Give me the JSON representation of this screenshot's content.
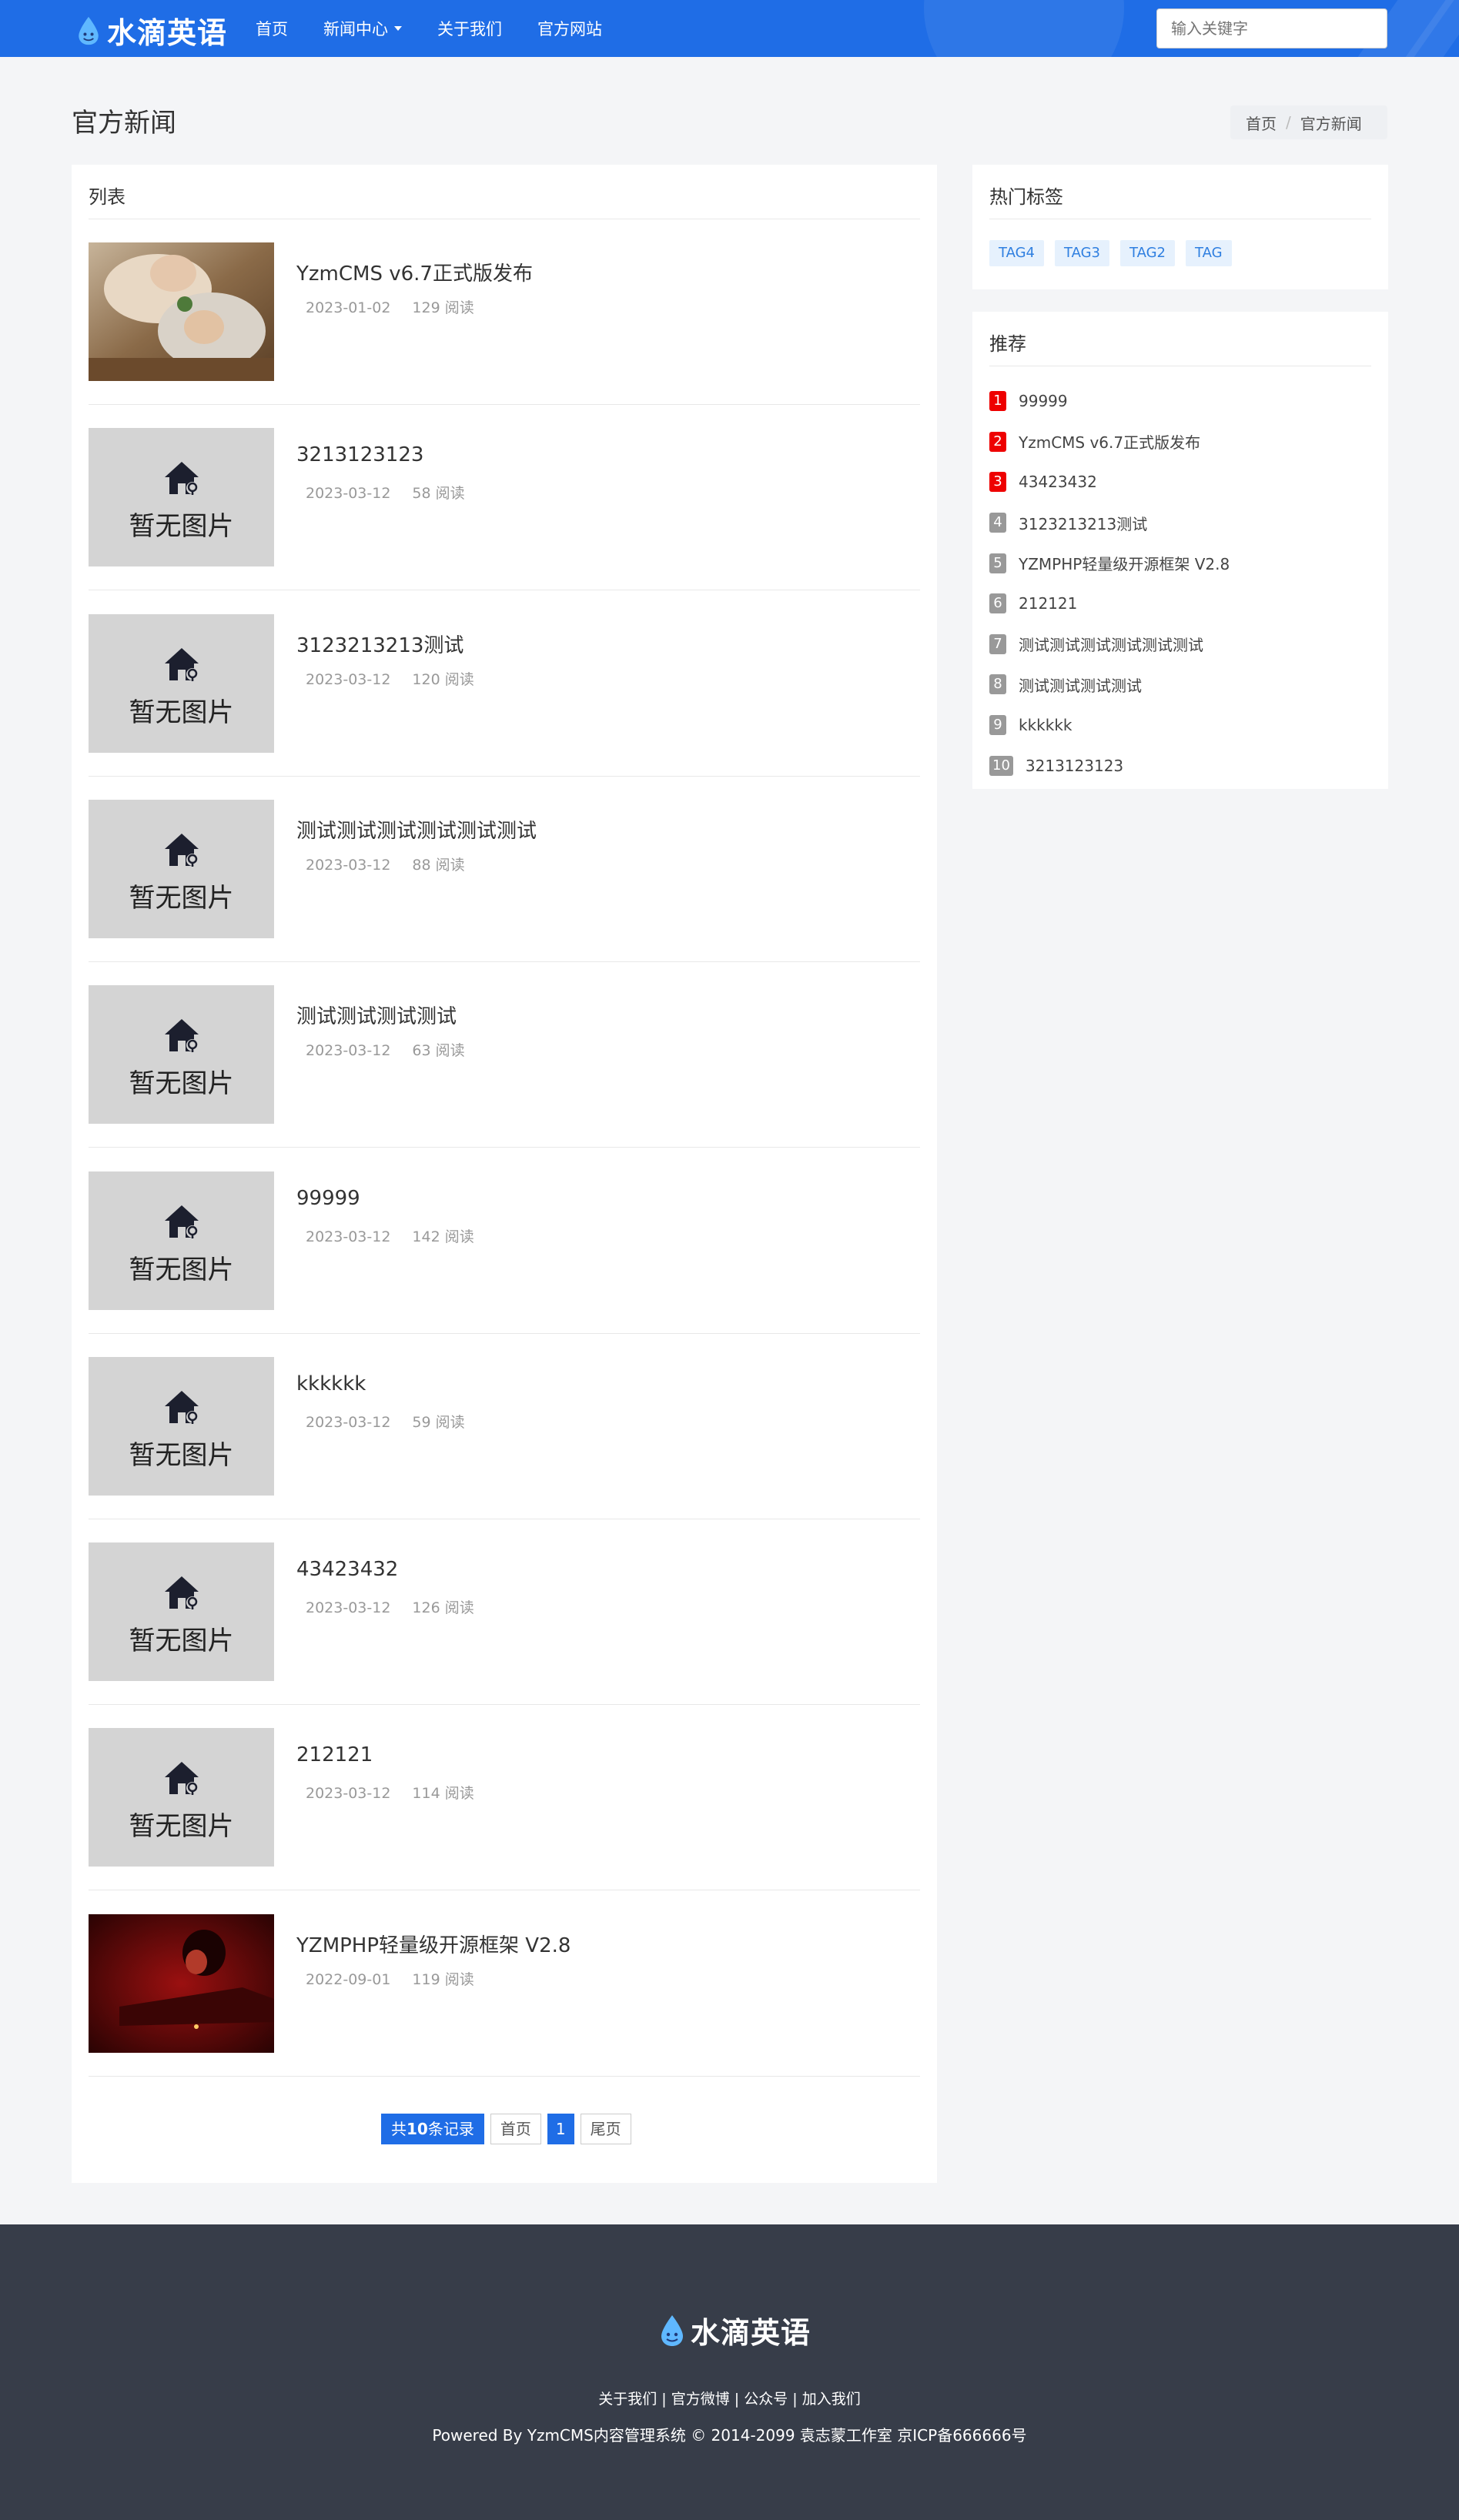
{
  "header": {
    "logo_text": "水滴英语",
    "nav": [
      "首页",
      "新闻中心",
      "关于我们",
      "官方网站"
    ],
    "search_placeholder": "输入关键字"
  },
  "page": {
    "title": "官方新闻",
    "breadcrumb": [
      "首页",
      "官方新闻"
    ]
  },
  "list": {
    "heading": "列表",
    "no_image_text": "暂无图片",
    "items": [
      {
        "title": "YzmCMS v6.7正式版发布",
        "date": "2023-01-02",
        "views": "129 阅读",
        "image": "photo-couple"
      },
      {
        "title": "3213123123",
        "date": "2023-03-12",
        "views": "58 阅读",
        "image": "none"
      },
      {
        "title": "3123213213测试",
        "date": "2023-03-12",
        "views": "120 阅读",
        "image": "none"
      },
      {
        "title": "测试测试测试测试测试测试",
        "date": "2023-03-12",
        "views": "88 阅读",
        "image": "none"
      },
      {
        "title": "测试测试测试测试",
        "date": "2023-03-12",
        "views": "63 阅读",
        "image": "none"
      },
      {
        "title": "99999",
        "date": "2023-03-12",
        "views": "142 阅读",
        "image": "none"
      },
      {
        "title": "kkkkkk",
        "date": "2023-03-12",
        "views": "59 阅读",
        "image": "none"
      },
      {
        "title": "43423432",
        "date": "2023-03-12",
        "views": "126 阅读",
        "image": "none"
      },
      {
        "title": "212121",
        "date": "2023-03-12",
        "views": "114 阅读",
        "image": "none"
      },
      {
        "title": "YZMPHP轻量级开源框架 V2.8",
        "date": "2022-09-01",
        "views": "119 阅读",
        "image": "photo-red"
      }
    ]
  },
  "pagination": {
    "total_prefix": "共",
    "total_count": "10",
    "total_suffix": "条记录",
    "first": "首页",
    "current": "1",
    "last": "尾页"
  },
  "sidebar": {
    "tags_heading": "热门标签",
    "tags": [
      "TAG4",
      "TAG3",
      "TAG2",
      "TAG"
    ],
    "rec_heading": "推荐",
    "rec_items": [
      {
        "num": "1",
        "title": "99999"
      },
      {
        "num": "2",
        "title": "YzmCMS v6.7正式版发布"
      },
      {
        "num": "3",
        "title": "43423432"
      },
      {
        "num": "4",
        "title": "3123213213测试"
      },
      {
        "num": "5",
        "title": "YZMPHP轻量级开源框架 V2.8"
      },
      {
        "num": "6",
        "title": "212121"
      },
      {
        "num": "7",
        "title": "测试测试测试测试测试测试"
      },
      {
        "num": "8",
        "title": "测试测试测试测试"
      },
      {
        "num": "9",
        "title": "kkkkkk"
      },
      {
        "num": "10",
        "title": "3213123123"
      }
    ]
  },
  "footer": {
    "logo_text": "水滴英语",
    "links": [
      "关于我们",
      "官方微博",
      "公众号",
      "加入我们"
    ],
    "copyright": "Powered By YzmCMS内容管理系统 © 2014-2099 袁志蒙工作室 京ICP备666666号"
  },
  "colors": {
    "brand_blue": "#1f6de6",
    "hot_red": "#ee0000",
    "footer_bg": "#373d49"
  }
}
